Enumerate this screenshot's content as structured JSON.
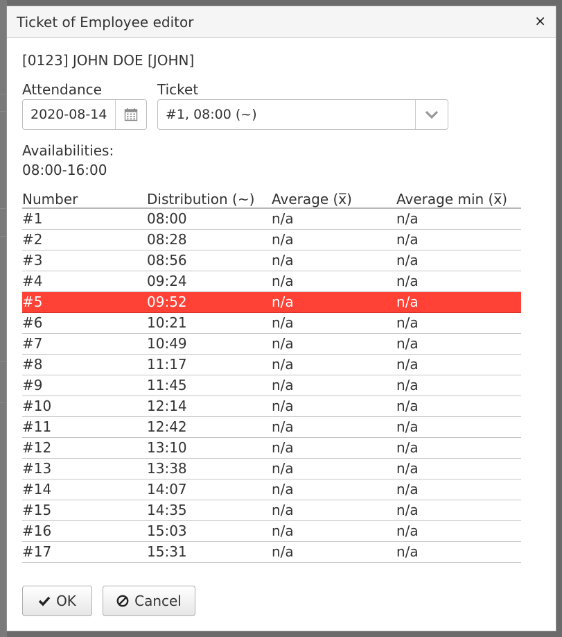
{
  "dialog": {
    "title": "Ticket of Employee editor",
    "close_label": "×"
  },
  "employee": "[0123] JOHN DOE [JOHN]",
  "attendance": {
    "label": "Attendance",
    "value": "2020-08-14"
  },
  "ticket": {
    "label": "Ticket",
    "value": "#1, 08:00 (~)"
  },
  "availabilities": {
    "label": "Availabilities:",
    "value": "08:00-16:00"
  },
  "table": {
    "headers": [
      "Number",
      "Distribution (~)",
      "Average (x̅)",
      "Average min (x̅)"
    ],
    "selected_row": 4,
    "rows": [
      [
        "#1",
        "08:00",
        "n/a",
        "n/a"
      ],
      [
        "#2",
        "08:28",
        "n/a",
        "n/a"
      ],
      [
        "#3",
        "08:56",
        "n/a",
        "n/a"
      ],
      [
        "#4",
        "09:24",
        "n/a",
        "n/a"
      ],
      [
        "#5",
        "09:52",
        "n/a",
        "n/a"
      ],
      [
        "#6",
        "10:21",
        "n/a",
        "n/a"
      ],
      [
        "#7",
        "10:49",
        "n/a",
        "n/a"
      ],
      [
        "#8",
        "11:17",
        "n/a",
        "n/a"
      ],
      [
        "#9",
        "11:45",
        "n/a",
        "n/a"
      ],
      [
        "#10",
        "12:14",
        "n/a",
        "n/a"
      ],
      [
        "#11",
        "12:42",
        "n/a",
        "n/a"
      ],
      [
        "#12",
        "13:10",
        "n/a",
        "n/a"
      ],
      [
        "#13",
        "13:38",
        "n/a",
        "n/a"
      ],
      [
        "#14",
        "14:07",
        "n/a",
        "n/a"
      ],
      [
        "#15",
        "14:35",
        "n/a",
        "n/a"
      ],
      [
        "#16",
        "15:03",
        "n/a",
        "n/a"
      ],
      [
        "#17",
        "15:31",
        "n/a",
        "n/a"
      ]
    ]
  },
  "buttons": {
    "ok_label": "OK",
    "cancel_label": "Cancel"
  },
  "colors": {
    "selected_row": "#ff4136"
  }
}
